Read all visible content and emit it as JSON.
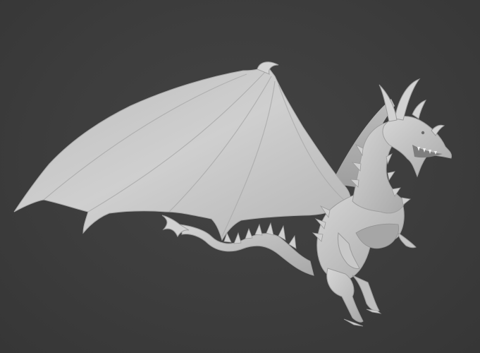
{
  "viewport": {
    "background_color": "#3d3d3d",
    "model_color": "#c9c9c9",
    "model_shadow_color": "#9a9a9a",
    "subject": "dragon-sculpt"
  }
}
